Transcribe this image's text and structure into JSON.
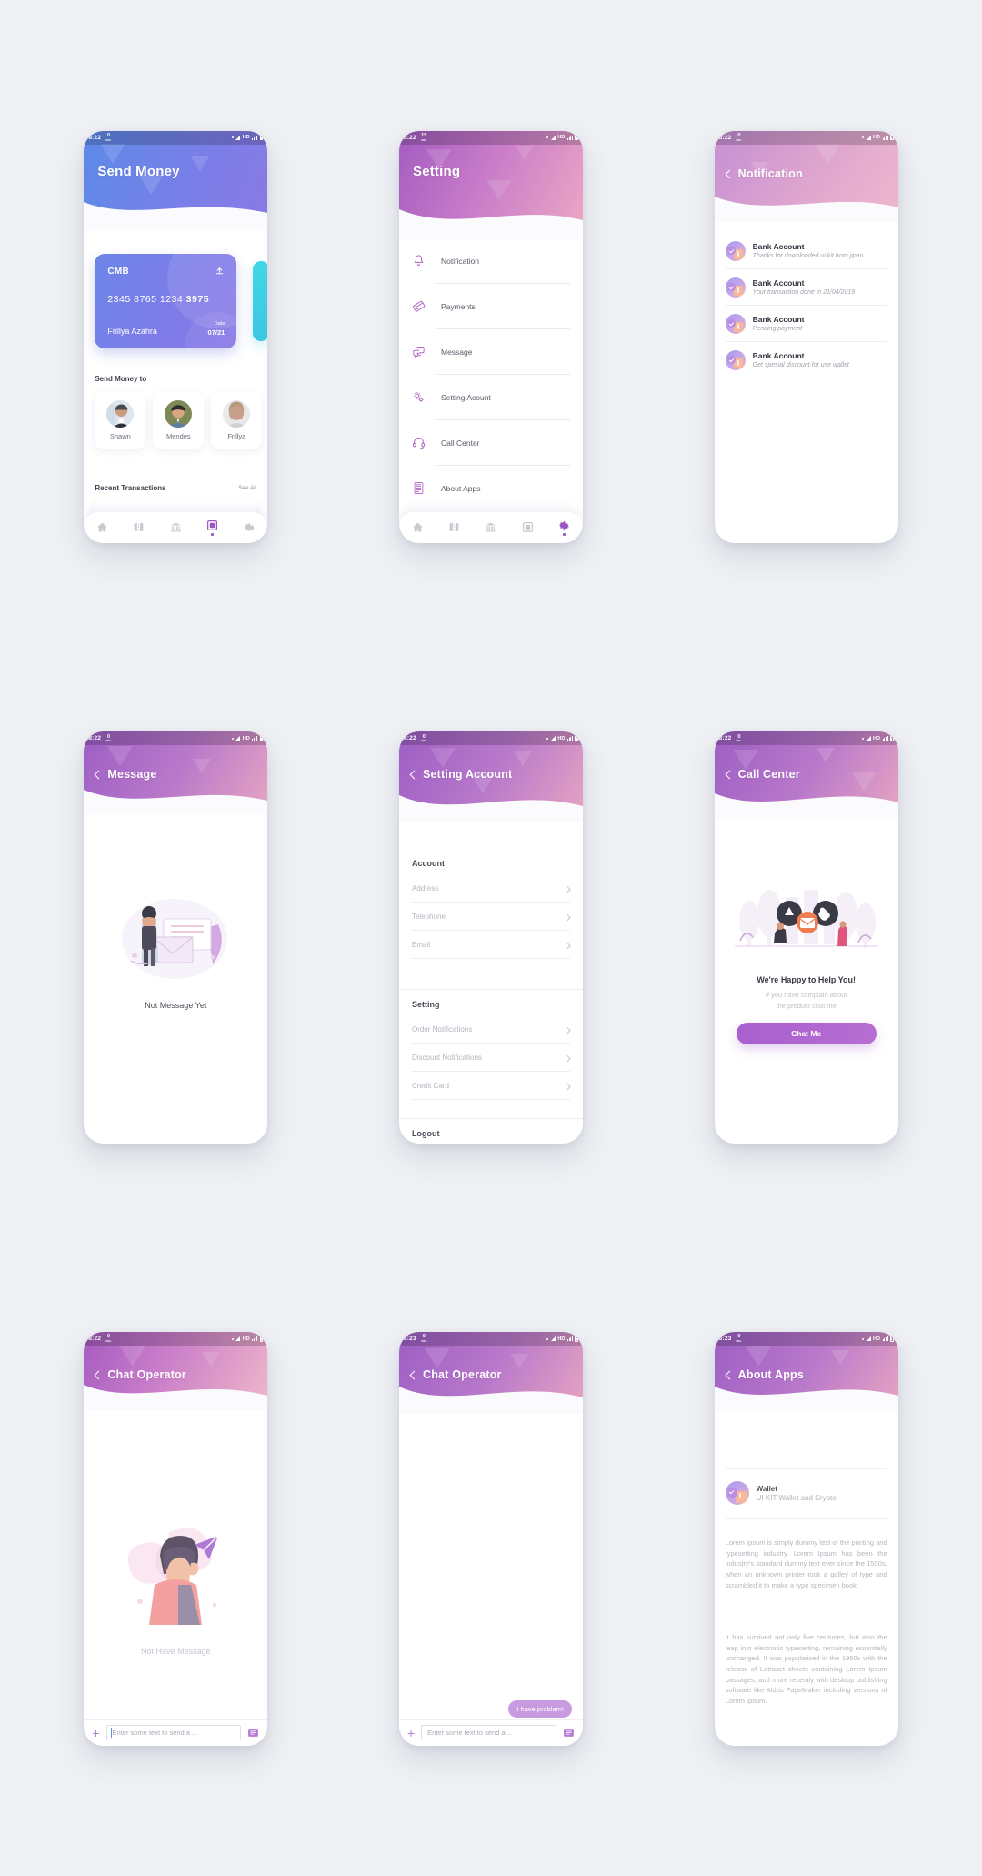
{
  "statusbar": {
    "time_822": "8:22",
    "time_823": "8:23",
    "kb_0": "0",
    "kb_15": "15",
    "kb_unit": "KB/s",
    "hd": "HD"
  },
  "screens": {
    "send_money": {
      "title": "Send Money",
      "card": {
        "bank": "CMB",
        "number": "2345  8765  1234",
        "number_last": "3975",
        "holder": "Frillya Azahra",
        "date_label": "Date",
        "date_value": "07/21"
      },
      "send_to_label": "Send Money to",
      "contacts": [
        {
          "name": "Shawn"
        },
        {
          "name": "Mendes"
        },
        {
          "name": "Frillya"
        }
      ],
      "recent_label": "Recent Transactions",
      "see_all": "See All"
    },
    "setting": {
      "title": "Setting",
      "items": [
        {
          "label": "Notification",
          "icon": "bell-icon"
        },
        {
          "label": "Payments",
          "icon": "card-icon"
        },
        {
          "label": "Message",
          "icon": "chat-icon"
        },
        {
          "label": "Setting Acount",
          "icon": "gear-icon"
        },
        {
          "label": "Call Center",
          "icon": "headset-icon"
        },
        {
          "label": "About Apps",
          "icon": "apps-icon"
        }
      ]
    },
    "notification": {
      "title": "Notification",
      "items": [
        {
          "title": "Bank Account",
          "subtitle": "Thanks for downloaded ui kit from jipau"
        },
        {
          "title": "Bank Account",
          "subtitle": "Your transaction done in 21/04/2019"
        },
        {
          "title": "Bank Account",
          "subtitle": "Pending payment"
        },
        {
          "title": "Bank Account",
          "subtitle": "Get spesial discount for use wallet"
        }
      ]
    },
    "message": {
      "title": "Message",
      "empty_text": "Not Message Yet"
    },
    "setting_account": {
      "title": "Setting Account",
      "group_account": "Account",
      "account_items": [
        {
          "label": "Address"
        },
        {
          "label": "Telephone"
        },
        {
          "label": "Email"
        }
      ],
      "group_setting": "Setting",
      "setting_items": [
        {
          "label": "Order Notifications"
        },
        {
          "label": "Discount Notifications"
        },
        {
          "label": "Credit Card"
        }
      ],
      "logout": "Logout"
    },
    "call_center": {
      "title": "Call Center",
      "heading": "We're Happy to Help You!",
      "sub_line1": "If you have complain about",
      "sub_line2": "the product chat me",
      "button": "Chat Me"
    },
    "chat_empty": {
      "title": "Chat Operator",
      "empty_text": "Not Have Message",
      "input_placeholder": "Enter some text to send a ..."
    },
    "chat_active": {
      "title": "Chat Operator",
      "message": "I have problem!",
      "input_placeholder": "Enter some text to send a ..."
    },
    "about_apps": {
      "title": "About Apps",
      "app_name": "Wallet",
      "app_sub": "UI KIT Wallet and Crypto",
      "para1": "Lorem Ipsum is simply dummy text of the printing and typesetting industry. Lorem Ipsum has been the industry's standard dummy text ever since the 1500s, when an unknown printer took a galley of type and scrambled it to make a type specimen book.",
      "para2": "It has survived not only five centuries, but also the leap into electronic typesetting, remaining essentially unchanged. It was popularised in the 1960s with the release of Letraset sheets containing Lorem Ipsum passages, and more recently with desktop publishing software like Aldus PageMaker including versions of Lorem Ipsum."
    }
  },
  "bottom_nav": [
    {
      "icon": "home-icon",
      "active": false
    },
    {
      "icon": "wallet-icon",
      "active": false
    },
    {
      "icon": "bank-icon",
      "active": false
    },
    {
      "icon": "card-nav-icon",
      "active": true
    },
    {
      "icon": "gear-nav-icon",
      "active": false
    }
  ],
  "bottom_nav_setting": [
    {
      "icon": "home-icon",
      "active": false
    },
    {
      "icon": "wallet-icon",
      "active": false
    },
    {
      "icon": "bank-icon",
      "active": false
    },
    {
      "icon": "card-nav-icon",
      "active": false
    },
    {
      "icon": "gear-nav-icon",
      "active": true
    }
  ],
  "colors": {
    "accent_purple": "#a95fce",
    "accent_blue": "#7b7ee8",
    "accent_pink": "#eda9c4",
    "cyan_card": "#45d6e8",
    "bg": "#eef0f4"
  }
}
